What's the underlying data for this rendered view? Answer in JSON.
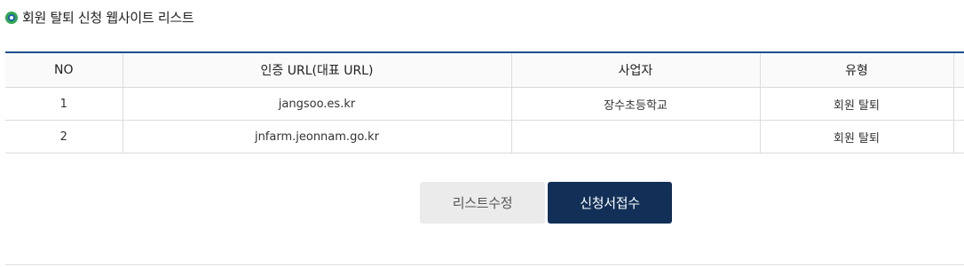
{
  "section": {
    "title": "회원 탈퇴 신청 웹사이트 리스트",
    "bullet_icon": "circle-bullet-icon"
  },
  "table": {
    "headers": [
      "NO",
      "인증 URL(대표 URL)",
      "사업자",
      "유형"
    ],
    "rows": [
      [
        "1",
        "jangsoo.es.kr",
        "장수초등학교",
        "회원 탈퇴"
      ],
      [
        "2",
        "jnfarm.jeonnam.go.kr",
        "",
        "회원 탈퇴"
      ]
    ]
  },
  "buttons": {
    "edit_label": "리스트수정",
    "submit_label": "신청서접수"
  },
  "colors": {
    "accent": "#1d4f91",
    "primary_button": "#123057",
    "secondary_button": "#ebebeb",
    "bullet_outer": "#2fa84f",
    "bullet_inner": "#1f5fb4"
  }
}
